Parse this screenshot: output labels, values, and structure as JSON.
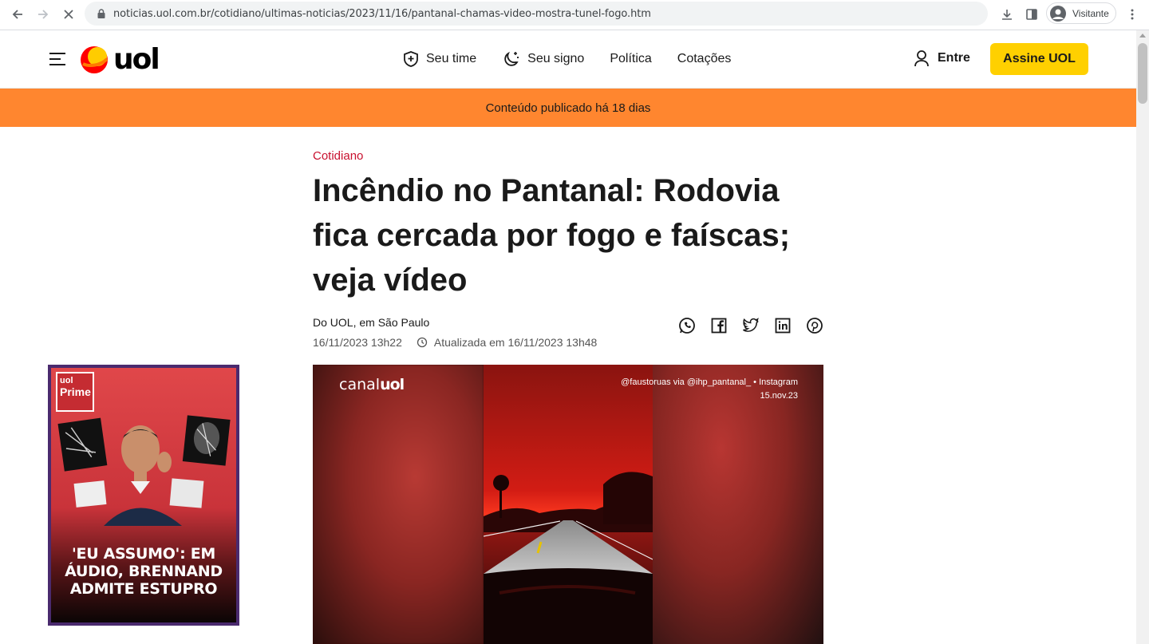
{
  "browser": {
    "url": "noticias.uol.com.br/cotidiano/ultimas-noticias/2023/11/16/pantanal-chamas-video-mostra-tunel-fogo.htm",
    "profile_label": "Visitante"
  },
  "header": {
    "logo_text": "uol",
    "nav": [
      {
        "label": "Seu time",
        "icon": "shield-plus-icon"
      },
      {
        "label": "Seu signo",
        "icon": "moon-star-icon"
      },
      {
        "label": "Política"
      },
      {
        "label": "Cotações"
      }
    ],
    "login_label": "Entre",
    "subscribe_label": "Assine UOL"
  },
  "banner": {
    "text": "Conteúdo publicado há 18 dias"
  },
  "article": {
    "kicker": "Cotidiano",
    "headline": "Incêndio no Pantanal: Rodovia fica cercada por fogo e faíscas; veja vídeo",
    "byline": "Do UOL, em São Paulo",
    "published": "16/11/2023 13h22",
    "updated": "Atualizada em 16/11/2023 13h48",
    "share_icons": [
      "whatsapp-icon",
      "facebook-icon",
      "twitter-icon",
      "linkedin-icon",
      "pinterest-icon"
    ]
  },
  "video": {
    "brand_prefix": "canal",
    "brand_suffix": "uol",
    "credit_line1": "@faustoruas via @ihp_pantanal_ • Instagram",
    "credit_line2": "15.nov.23"
  },
  "ad": {
    "badge_top": "uol",
    "badge_bottom": "Prime",
    "caption": "'EU ASSUMO': EM ÁUDIO, BRENNAND ADMITE ESTUPRO"
  },
  "colors": {
    "accent_red": "#c8102e",
    "banner_orange": "#ff862f",
    "subscribe_yellow": "#ffd000"
  }
}
